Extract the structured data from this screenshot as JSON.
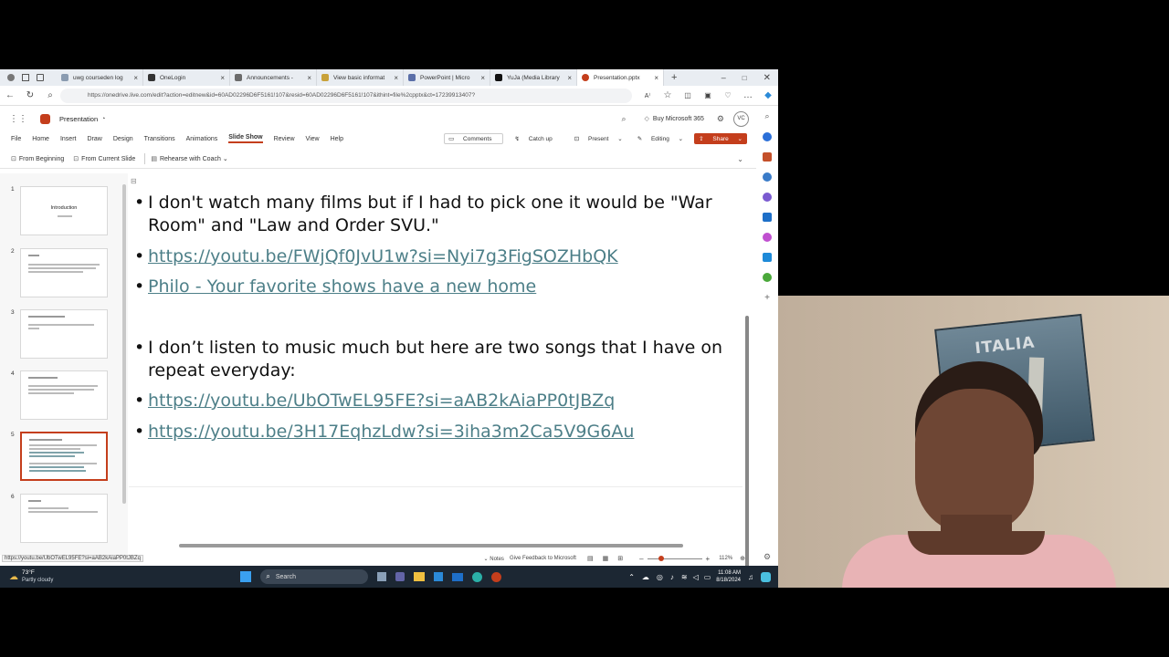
{
  "browser": {
    "tabs": [
      {
        "label": "uwg courseden log",
        "color": "#8a9bb0"
      },
      {
        "label": "OneLogin",
        "color": "#333333"
      },
      {
        "label": "Announcements - ",
        "color": "#6b6b6b"
      },
      {
        "label": "View basic informat",
        "color": "#c9a23a"
      },
      {
        "label": "PowerPoint | Micro",
        "color": "#5b6fa8"
      },
      {
        "label": "YuJa (Media Library",
        "color": "#111111"
      },
      {
        "label": "Presentation.pptx",
        "color": "#c43e1c"
      }
    ],
    "url": "https://onedrive.live.com/edit?action=editnew&id=60AD02296D6F5161!107&resid=60AD02296D6F5161!107&ithint=file%2cpptx&ct=17239913407?"
  },
  "app": {
    "name": "Presentation",
    "buy_label": "Buy Microsoft 365",
    "avatar": "VC"
  },
  "ribbon": {
    "tabs": [
      "File",
      "Home",
      "Insert",
      "Draw",
      "Design",
      "Transitions",
      "Animations",
      "Slide Show",
      "Review",
      "View",
      "Help"
    ],
    "active": "Slide Show",
    "comments": "Comments",
    "catchup": "Catch up",
    "present": "Present",
    "editing": "Editing",
    "share": "Share"
  },
  "toolbar": {
    "from_beginning": "From Beginning",
    "from_current": "From Current Slide",
    "rehearse": "Rehearse with Coach"
  },
  "thumbnails": [
    {
      "num": "1",
      "title": "Introduction"
    },
    {
      "num": "2",
      "title": ""
    },
    {
      "num": "3",
      "title": ""
    },
    {
      "num": "4",
      "title": ""
    },
    {
      "num": "5",
      "title": ""
    },
    {
      "num": "6",
      "title": ""
    }
  ],
  "slide": {
    "b1": "I don't watch many films but if I had to pick one it would be \"War Room\" and \"Law and Order SVU.\"",
    "link1": "https://youtu.be/FWjQf0JvU1w?si=Nyi7g3FigSOZHbQK",
    "link2": "Philo - Your favorite shows have a new home",
    "b2": "I don’t listen to music much but here are two songs that I have on repeat everyday:",
    "link3": "https://youtu.be/UbOTwEL95FE?si=aAB2kAiaPP0tJBZq",
    "link4": "https://youtu.be/3H17EqhzLdw?si=3iha3m2Ca5V9G6Au"
  },
  "status": {
    "hover_url": "https://youtu.be/UbOTwEL95FE?si=aAB2kAiaPP0tJBZq",
    "notes": "Notes",
    "feedback": "Give Feedback to Microsoft",
    "zoom": "112%"
  },
  "taskbar": {
    "weather_temp": "73°F",
    "weather_desc": "Partly cloudy",
    "search": "Search",
    "time": "11:08 AM",
    "date": "8/18/2024"
  },
  "webcam": {
    "poster_text": "ITALIA"
  },
  "colors": {
    "accent": "#c43e1c",
    "link": "#4d7f88"
  }
}
